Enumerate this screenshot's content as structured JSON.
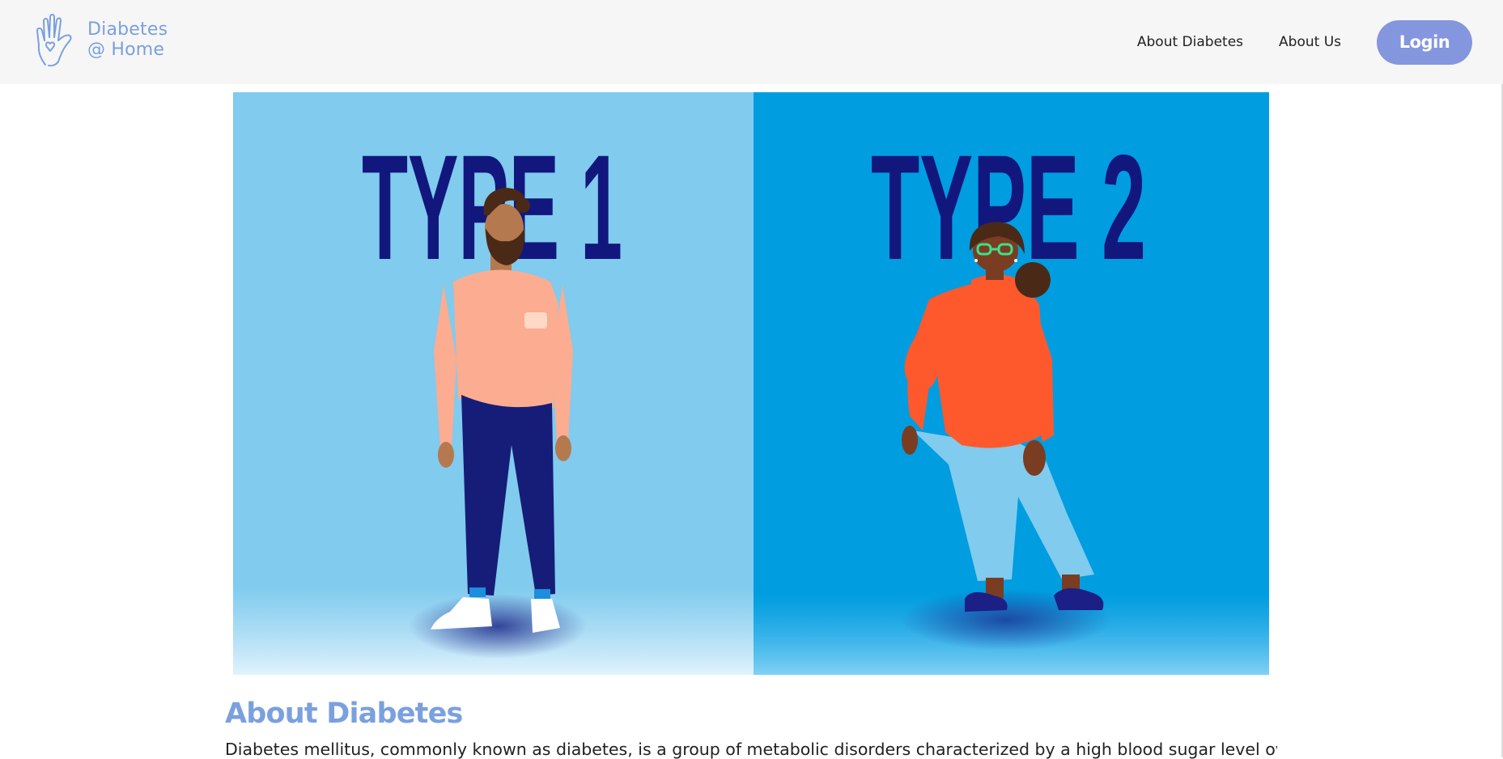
{
  "brand": {
    "line1": "Diabetes",
    "line2": "@ Home",
    "color": "#7aa0df"
  },
  "nav": {
    "links": [
      {
        "label": "About Diabetes"
      },
      {
        "label": "About Us"
      }
    ],
    "login_label": "Login",
    "login_color": "#8496dd"
  },
  "hero": {
    "left_label": "TYPE 1",
    "right_label": "TYPE 2",
    "left_bg": "#80cbee",
    "right_bg": "#009de0",
    "label_color": "#12177e"
  },
  "main": {
    "heading": "About Diabetes",
    "intro": "Diabetes mellitus, commonly known as diabetes, is a group of metabolic disorders characterized by a high blood sugar level over"
  }
}
